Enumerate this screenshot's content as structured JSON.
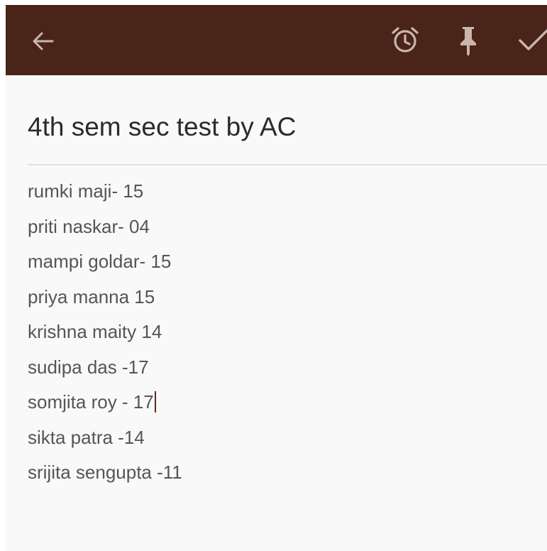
{
  "toolbar": {
    "background_color": "#4a2418",
    "icon_color": "#c9b6ae",
    "back_icon": "arrow-back-icon",
    "alarm_icon": "alarm-clock-icon",
    "pin_icon": "pin-icon",
    "done_icon": "checkmark-icon"
  },
  "note": {
    "title": "4th sem sec test by AC",
    "lines": [
      "rumki maji- 15",
      "priti naskar-  04",
      "mampi goldar- 15",
      "priya manna 15",
      "krishna maity 14",
      "sudipa das -17",
      "somjita roy - 17",
      "sikta patra -14",
      "srijita sengupta -11"
    ],
    "caret_after_line": 6,
    "caret_color": "#5a2a1a"
  }
}
